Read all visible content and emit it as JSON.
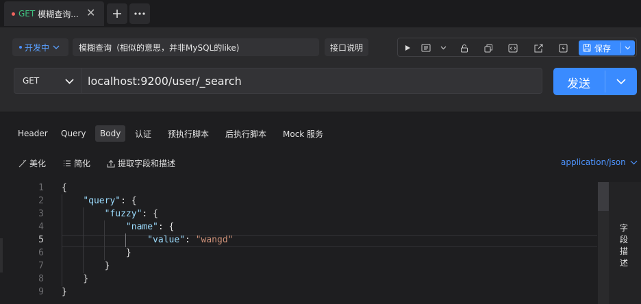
{
  "tab": {
    "method": "GET",
    "name": "模糊查询...",
    "close_icon": "close-icon"
  },
  "tab_actions": {
    "add_icon": "plus-icon",
    "more_icon": "more-icon"
  },
  "header": {
    "status": "开发中",
    "description": "模糊查询（相似的意思，并非MySQL的like)",
    "doc_button": "接口说明",
    "save_label": "保存"
  },
  "request": {
    "method": "GET",
    "url": "localhost:9200/user/_search",
    "send_label": "发送"
  },
  "req_tabs": [
    "Header",
    "Query",
    "Body",
    "认证",
    "预执行脚本",
    "后执行脚本",
    "Mock 服务"
  ],
  "active_tab": "Body",
  "body_actions": {
    "beautify": "美化",
    "simplify": "简化",
    "extract": "提取字段和描述",
    "content_type": "application/json"
  },
  "side_panel_label": [
    "字",
    "段",
    "描",
    "述"
  ],
  "editor": {
    "line_numbers": [
      "1",
      "2",
      "3",
      "4",
      "5",
      "6",
      "7",
      "8",
      "9"
    ],
    "current_line": 5,
    "lines": [
      {
        "indent": "",
        "parts": [
          [
            "p",
            "{"
          ]
        ]
      },
      {
        "indent": "    ",
        "parts": [
          [
            "k",
            "\"query\""
          ],
          [
            "p",
            ": {"
          ]
        ]
      },
      {
        "indent": "        ",
        "parts": [
          [
            "k",
            "\"fuzzy\""
          ],
          [
            "p",
            ": {"
          ]
        ]
      },
      {
        "indent": "            ",
        "parts": [
          [
            "k",
            "\"name\""
          ],
          [
            "p",
            ": {"
          ]
        ]
      },
      {
        "indent": "                ",
        "parts": [
          [
            "k",
            "\"value\""
          ],
          [
            "p",
            ": "
          ],
          [
            "s",
            "\"wangd\""
          ]
        ]
      },
      {
        "indent": "            ",
        "parts": [
          [
            "p",
            "}"
          ]
        ]
      },
      {
        "indent": "        ",
        "parts": [
          [
            "p",
            "}"
          ]
        ]
      },
      {
        "indent": "    ",
        "parts": [
          [
            "p",
            "}"
          ]
        ]
      },
      {
        "indent": "",
        "parts": [
          [
            "p",
            "}"
          ]
        ]
      }
    ]
  },
  "colors": {
    "accent": "#3a8bff",
    "method_get": "#3fbf7f",
    "status": "#5aa0ff",
    "key": "#9cdcfe",
    "string": "#ce9178"
  }
}
